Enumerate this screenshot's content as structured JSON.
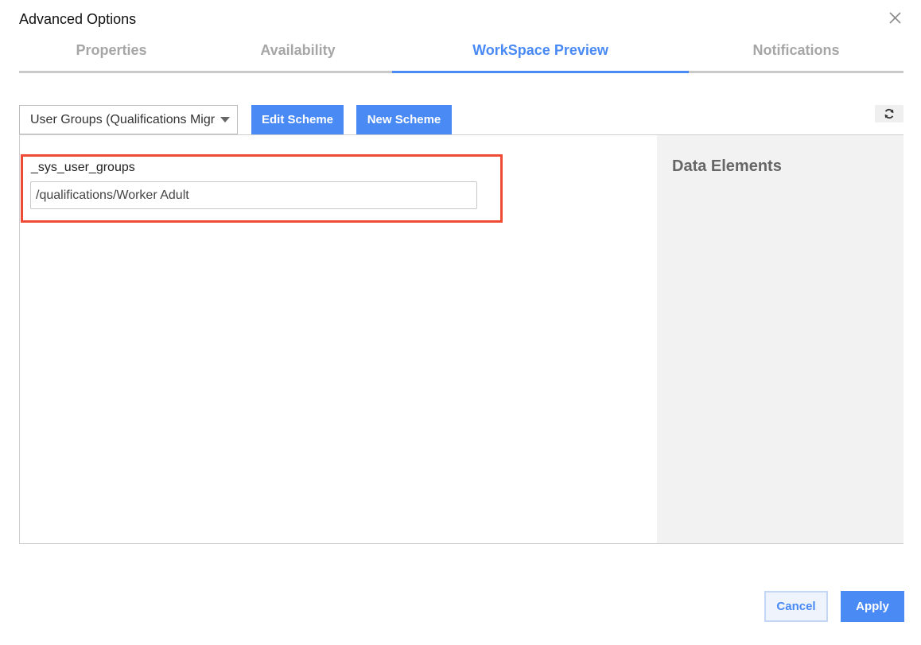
{
  "dialog": {
    "title": "Advanced Options"
  },
  "tabs": [
    {
      "label": "Properties",
      "active": false
    },
    {
      "label": "Availability",
      "active": false
    },
    {
      "label": "WorkSpace Preview",
      "active": true
    },
    {
      "label": "Notifications",
      "active": false
    }
  ],
  "toolbar": {
    "scheme_select_value": "User Groups (Qualifications Migr",
    "edit_scheme_label": "Edit Scheme",
    "new_scheme_label": "New Scheme"
  },
  "form": {
    "field_label": "_sys_user_groups",
    "field_value": "/qualifications/Worker Adult"
  },
  "side_panel": {
    "title": "Data Elements"
  },
  "footer": {
    "cancel_label": "Cancel",
    "apply_label": "Apply"
  },
  "colors": {
    "accent": "#4a8af4",
    "highlight": "#ef4b34",
    "tab_inactive": "#a6a6a6",
    "side_panel_bg": "#f2f2f2"
  },
  "icons": {
    "close": "close-icon",
    "dropdown": "chevron-down-icon",
    "refresh": "refresh-icon"
  }
}
